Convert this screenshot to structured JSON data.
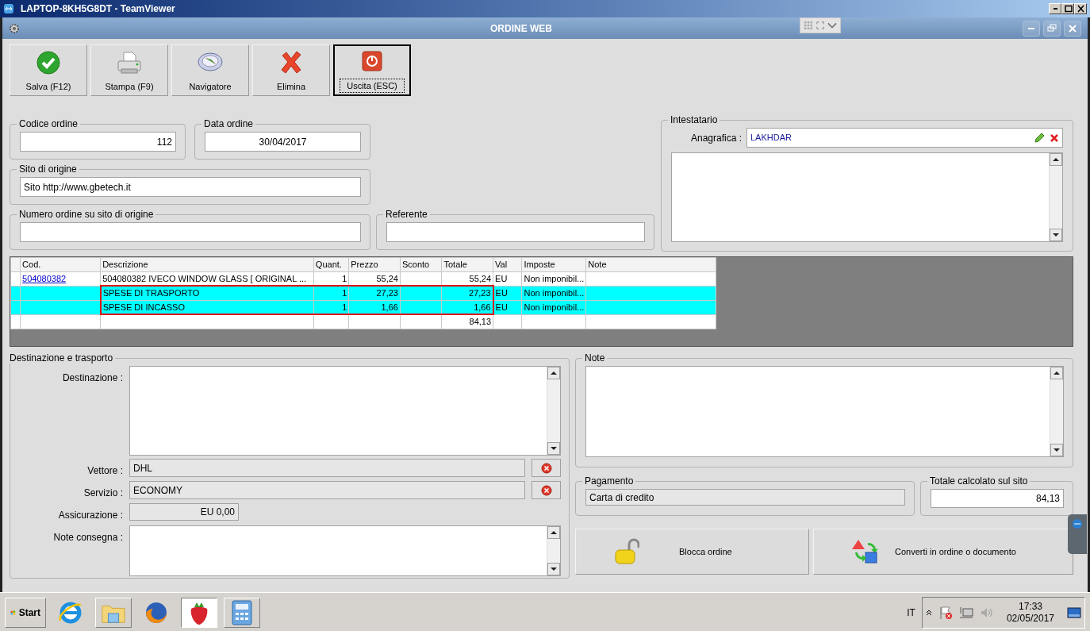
{
  "outer_window": {
    "title": "LAPTOP-8KH5G8DT - TeamViewer"
  },
  "window": {
    "title": "ORDINE WEB"
  },
  "toolbar": [
    {
      "label": "Salva (F12)",
      "kind": "save",
      "focused": false
    },
    {
      "label": "Stampa (F9)",
      "kind": "print",
      "focused": false
    },
    {
      "label": "Navigatore",
      "kind": "compass",
      "focused": false
    },
    {
      "label": "Elimina",
      "kind": "delete",
      "focused": false
    },
    {
      "label": "Uscita (ESC)",
      "kind": "exit",
      "focused": true
    }
  ],
  "order_code": {
    "legend": "Codice ordine",
    "value": "112"
  },
  "order_date": {
    "legend": "Data ordine",
    "value": "30/04/2017"
  },
  "origin_site": {
    "legend": "Sito di origine",
    "value": "Sito http://www.gbetech.it"
  },
  "origin_order_number": {
    "legend": "Numero ordine su sito di origine"
  },
  "referent": {
    "legend": "Referente"
  },
  "holder": {
    "legend": "Intestatario",
    "label": "Anagrafica :",
    "value": "LAKHDAR"
  },
  "table": {
    "columns": [
      "Cod.",
      "Descrizione",
      "Quant.",
      "Prezzo",
      "Sconto",
      "Totale",
      "Val",
      "Imposte",
      "Note"
    ],
    "rows": [
      {
        "cells": [
          "504080382",
          "504080382 IVECO WINDOW GLASS [ ORIGINAL ...",
          "1",
          "55,24",
          null,
          "55,24",
          "EU",
          "Non imponibil...",
          null
        ],
        "selected": false,
        "marked": false
      },
      {
        "cells": [
          null,
          "SPESE DI TRASPORTO",
          "1",
          "27,23",
          null,
          "27,23",
          "EU",
          "Non imponibil...",
          null
        ],
        "selected": true,
        "marked": true
      },
      {
        "cells": [
          null,
          "SPESE DI INCASSO",
          "1",
          "1,66",
          null,
          "1,66",
          "EU",
          "Non imponibil...",
          null
        ],
        "selected": true,
        "marked": true
      },
      {
        "cells": [
          null,
          null,
          null,
          null,
          null,
          "84,13",
          null,
          null,
          null
        ],
        "selected": false,
        "marked": false
      }
    ]
  },
  "shipping": {
    "legend": "Destinazione e trasporto",
    "fields": [
      {
        "label": "Destinazione :",
        "kind": "textarea"
      },
      {
        "label": "Vettore :",
        "value": "DHL",
        "kind": "clearable"
      },
      {
        "label": "Servizio :",
        "value": "ECONOMY",
        "kind": "clearable"
      },
      {
        "label": "Assicurazione :",
        "value": "EU 0,00",
        "kind": "amount"
      },
      {
        "label": "Note consegna :",
        "kind": "textarea"
      }
    ]
  },
  "notes": {
    "legend": "Note"
  },
  "payment": {
    "legend": "Pagamento",
    "value": "Carta di credito"
  },
  "site_total": {
    "legend": "Totale calcolato sul sito",
    "value": "84,13"
  },
  "actions": [
    {
      "label": "Blocca ordine",
      "kind": "lock"
    },
    {
      "label": "Converti in ordine o documento",
      "kind": "convert"
    }
  ],
  "taskbar": {
    "start": "Start",
    "apps": [
      {
        "kind": "browser-e",
        "running": false,
        "selected": false
      },
      {
        "kind": "folder",
        "running": true,
        "selected": false
      },
      {
        "kind": "browser-fox",
        "running": false,
        "selected": false
      },
      {
        "kind": "strawberry",
        "running": true,
        "selected": true
      },
      {
        "kind": "calculator",
        "running": true,
        "selected": false
      }
    ],
    "language": "IT",
    "time": "17:33",
    "date": "02/05/2017"
  }
}
